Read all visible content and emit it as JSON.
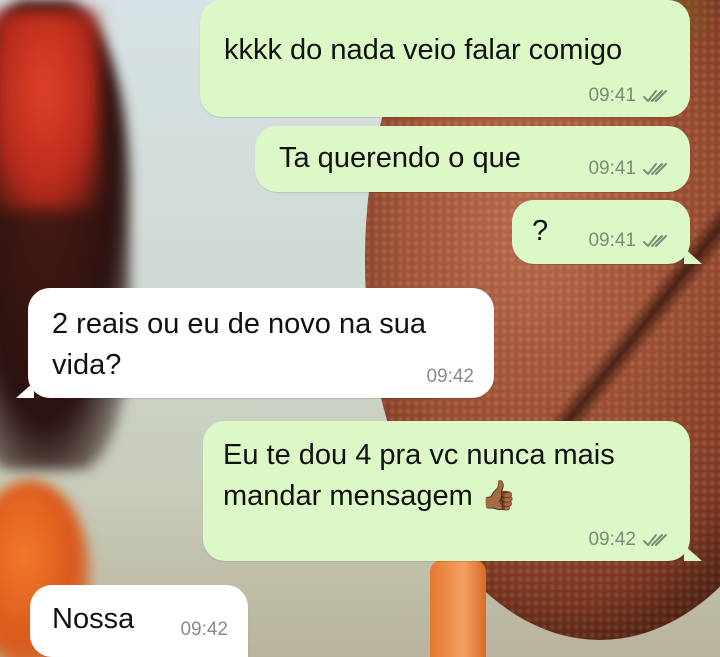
{
  "messages": [
    {
      "direction": "out",
      "text": "kkkk do nada veio falar comigo",
      "time": "09:41",
      "status": "read"
    },
    {
      "direction": "out",
      "text": "Ta querendo o que",
      "time": "09:41",
      "status": "read"
    },
    {
      "direction": "out",
      "text": "?",
      "time": "09:41",
      "status": "read"
    },
    {
      "direction": "in",
      "text": "2 reais ou eu de novo na sua vida?",
      "time": "09:42"
    },
    {
      "direction": "out",
      "text": "Eu te dou 4 pra vc nunca mais mandar mensagem",
      "emoji": "👍🏾",
      "time": "09:42",
      "status": "read"
    },
    {
      "direction": "in",
      "text": "Nossa",
      "time": "09:42"
    }
  ],
  "colors": {
    "outgoing_bubble": "#dcf8c6",
    "incoming_bubble": "#ffffff",
    "read_ticks": "#7a8b76"
  }
}
